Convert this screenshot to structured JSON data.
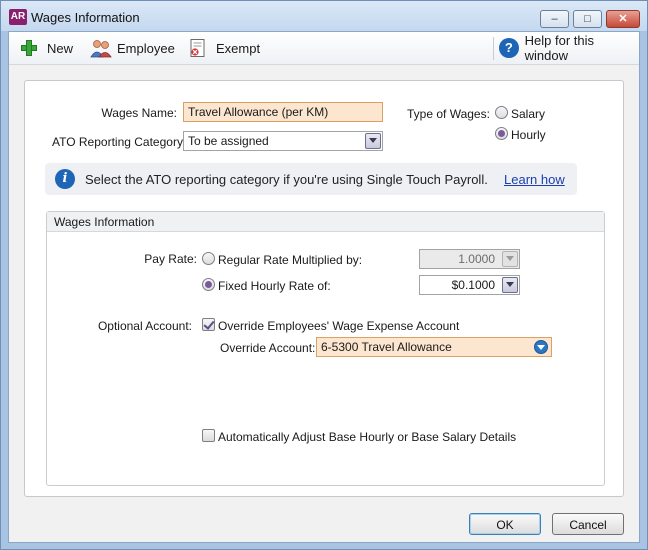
{
  "window": {
    "app_icon": "AR",
    "title": "Wages Information",
    "min_glyph": "–",
    "max_glyph": "□",
    "close_glyph": "✕"
  },
  "toolbar": {
    "new_label": "New",
    "employee_label": "Employee",
    "exempt_label": "Exempt",
    "help_label": "Help for this window",
    "help_glyph": "?"
  },
  "form": {
    "wages_name_label": "Wages Name:",
    "wages_name_value": "Travel Allowance (per KM)",
    "ato_label": "ATO Reporting Category:",
    "ato_value": "To be assigned",
    "type_label": "Type of Wages:",
    "type_options": [
      "Salary",
      "Hourly"
    ],
    "type_selected": "Hourly"
  },
  "info": {
    "glyph": "i",
    "text": "Select the ATO reporting category if you're using Single Touch Payroll.",
    "link": "Learn how"
  },
  "group": {
    "title": "Wages Information",
    "pay_rate_label": "Pay Rate:",
    "regular_rate_label": "Regular Rate Multiplied by:",
    "regular_rate_value": "1.0000",
    "fixed_rate_label": "Fixed Hourly Rate of:",
    "fixed_rate_value": "$0.1000",
    "pay_rate_selected": "Fixed Hourly Rate of:",
    "optional_account_label": "Optional Account:",
    "override_checkbox_label": "Override Employees' Wage Expense Account",
    "override_checked": true,
    "override_account_label": "Override Account:",
    "override_account_value": "6-5300 Travel Allowance",
    "auto_adjust_label": "Automatically Adjust Base Hourly or Base Salary Details",
    "auto_adjust_checked": false
  },
  "buttons": {
    "ok": "OK",
    "cancel": "Cancel"
  },
  "colors": {
    "highlight_field": "#fde6cf",
    "link": "#1a3fb0",
    "title_bar": "#c4d8ef"
  }
}
